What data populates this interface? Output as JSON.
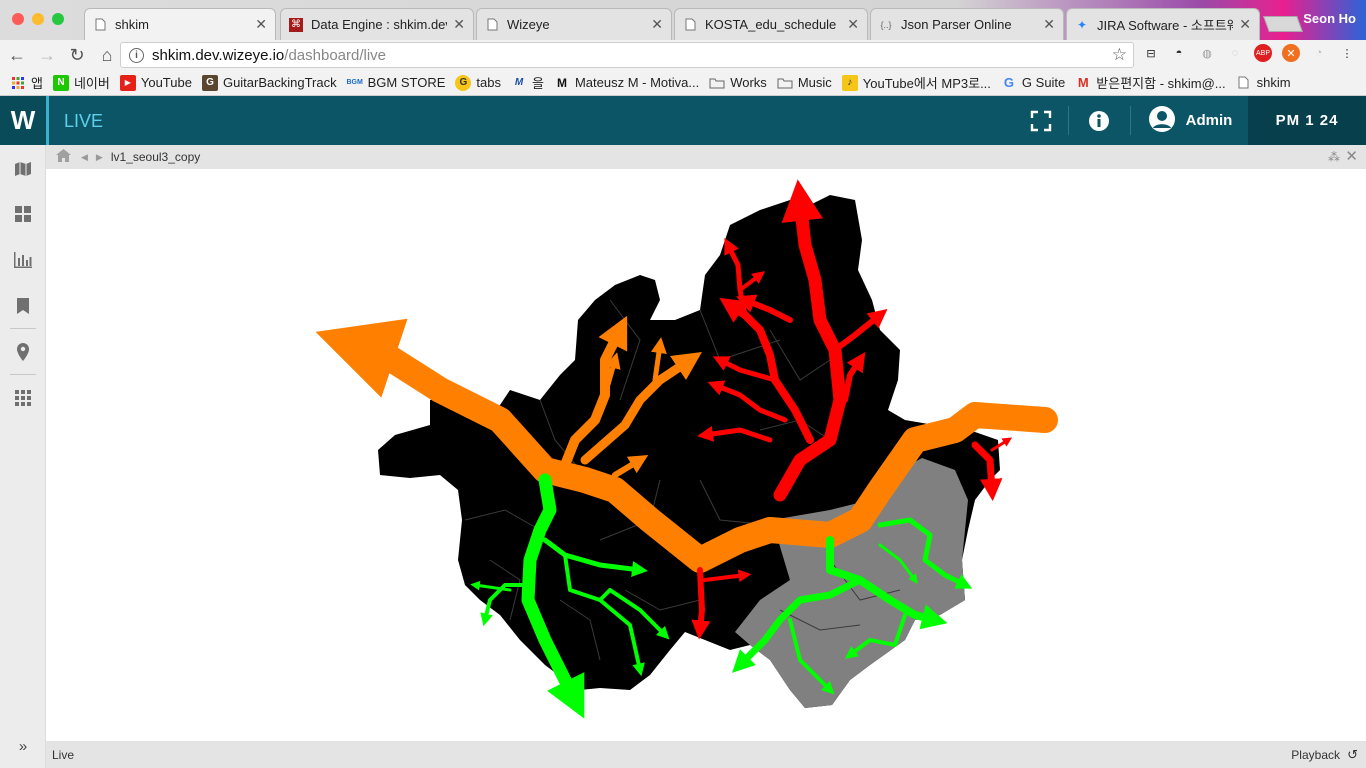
{
  "browser": {
    "tabs": [
      {
        "label": "shkim",
        "icon": "page-icon"
      },
      {
        "label": "Data Engine : shkim.dev.",
        "icon": "data-engine-icon"
      },
      {
        "label": "Wizeye",
        "icon": "page-icon"
      },
      {
        "label": "KOSTA_edu_schedule",
        "icon": "page-icon"
      },
      {
        "label": "Json Parser Online",
        "icon": "json-icon"
      },
      {
        "label": "JIRA Software - 소프트웨어",
        "icon": "jira-icon"
      }
    ],
    "profile_name": "Seon Ho",
    "url_host": "shkim.dev.wizeye.io",
    "url_path": "/dashboard/live",
    "bookmarks": [
      {
        "label": "앱",
        "icon": "apps-grid-icon"
      },
      {
        "label": "네이버",
        "icon": "naver-icon"
      },
      {
        "label": "YouTube",
        "icon": "youtube-icon"
      },
      {
        "label": "GuitarBackingTrack",
        "icon": "guitar-icon"
      },
      {
        "label": "BGM STORE",
        "icon": "bgm-store-icon"
      },
      {
        "label": "tabs",
        "icon": "tabs-icon"
      },
      {
        "label": "을",
        "icon": "m-icon"
      },
      {
        "label": "Mateusz M - Motiva...",
        "icon": "m-logo-icon"
      },
      {
        "label": "Works",
        "icon": "folder-icon"
      },
      {
        "label": "Music",
        "icon": "folder-icon"
      },
      {
        "label": "YouTube에서 MP3로...",
        "icon": "mp3-icon"
      },
      {
        "label": "G Suite",
        "icon": "google-icon"
      },
      {
        "label": "받은편지함 - shkim@...",
        "icon": "gmail-icon"
      },
      {
        "label": "shkim",
        "icon": "page-icon"
      }
    ]
  },
  "app": {
    "logo": "W",
    "title": "LIVE",
    "user": "Admin",
    "clock": "PM  1 24",
    "breadcrumb": "lv1_seoul3_copy",
    "status_left": "Live",
    "status_right": "Playback",
    "colors": {
      "header": "#0c5566",
      "accent": "#39b0cf",
      "title": "#5fd0ec"
    },
    "sidebar_icons": [
      "map-icon",
      "dashboard-grid-icon",
      "bar-chart-icon",
      "bookmark-icon",
      "location-pin-icon",
      "apps-icon"
    ]
  },
  "map": {
    "name": "lv1_seoul3_copy",
    "flows": [
      {
        "color": "#ff8000",
        "name": "orange",
        "description": "river-flow west-east"
      },
      {
        "color": "#ff0000",
        "name": "red"
      },
      {
        "color": "#00ff00",
        "name": "green"
      }
    ],
    "district_colors": {
      "default": "#000000",
      "highlight": "#808080"
    }
  }
}
